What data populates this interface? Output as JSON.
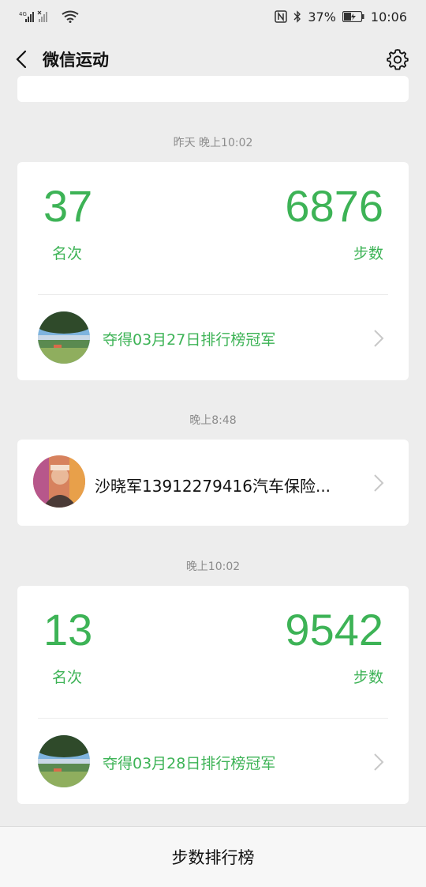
{
  "status_bar": {
    "network": "4G",
    "battery": "37%",
    "time": "10:06",
    "icons": [
      "signal-icon",
      "wifi-icon",
      "nfc-icon",
      "bluetooth-icon",
      "battery-icon"
    ]
  },
  "header": {
    "title": "微信运动",
    "back_icon": "back-arrow-icon",
    "settings_icon": "gear-icon"
  },
  "feed": [
    {
      "timestamp": "昨天 晚上10:02",
      "rank": "37",
      "rank_label": "名次",
      "steps": "6876",
      "steps_label": "步数",
      "champion_text": "夺得03月27日排行榜冠军"
    },
    {
      "timestamp": "晚上8:48",
      "message": "沙晓军13912279416汽车保险..."
    },
    {
      "timestamp": "晚上10:02",
      "rank": "13",
      "rank_label": "名次",
      "steps": "9542",
      "steps_label": "步数",
      "champion_text": "夺得03月28日排行榜冠军"
    }
  ],
  "bottom_bar": {
    "label": "步数排行榜"
  },
  "colors": {
    "accent": "#3db356",
    "background": "#ededed",
    "card": "#ffffff"
  }
}
